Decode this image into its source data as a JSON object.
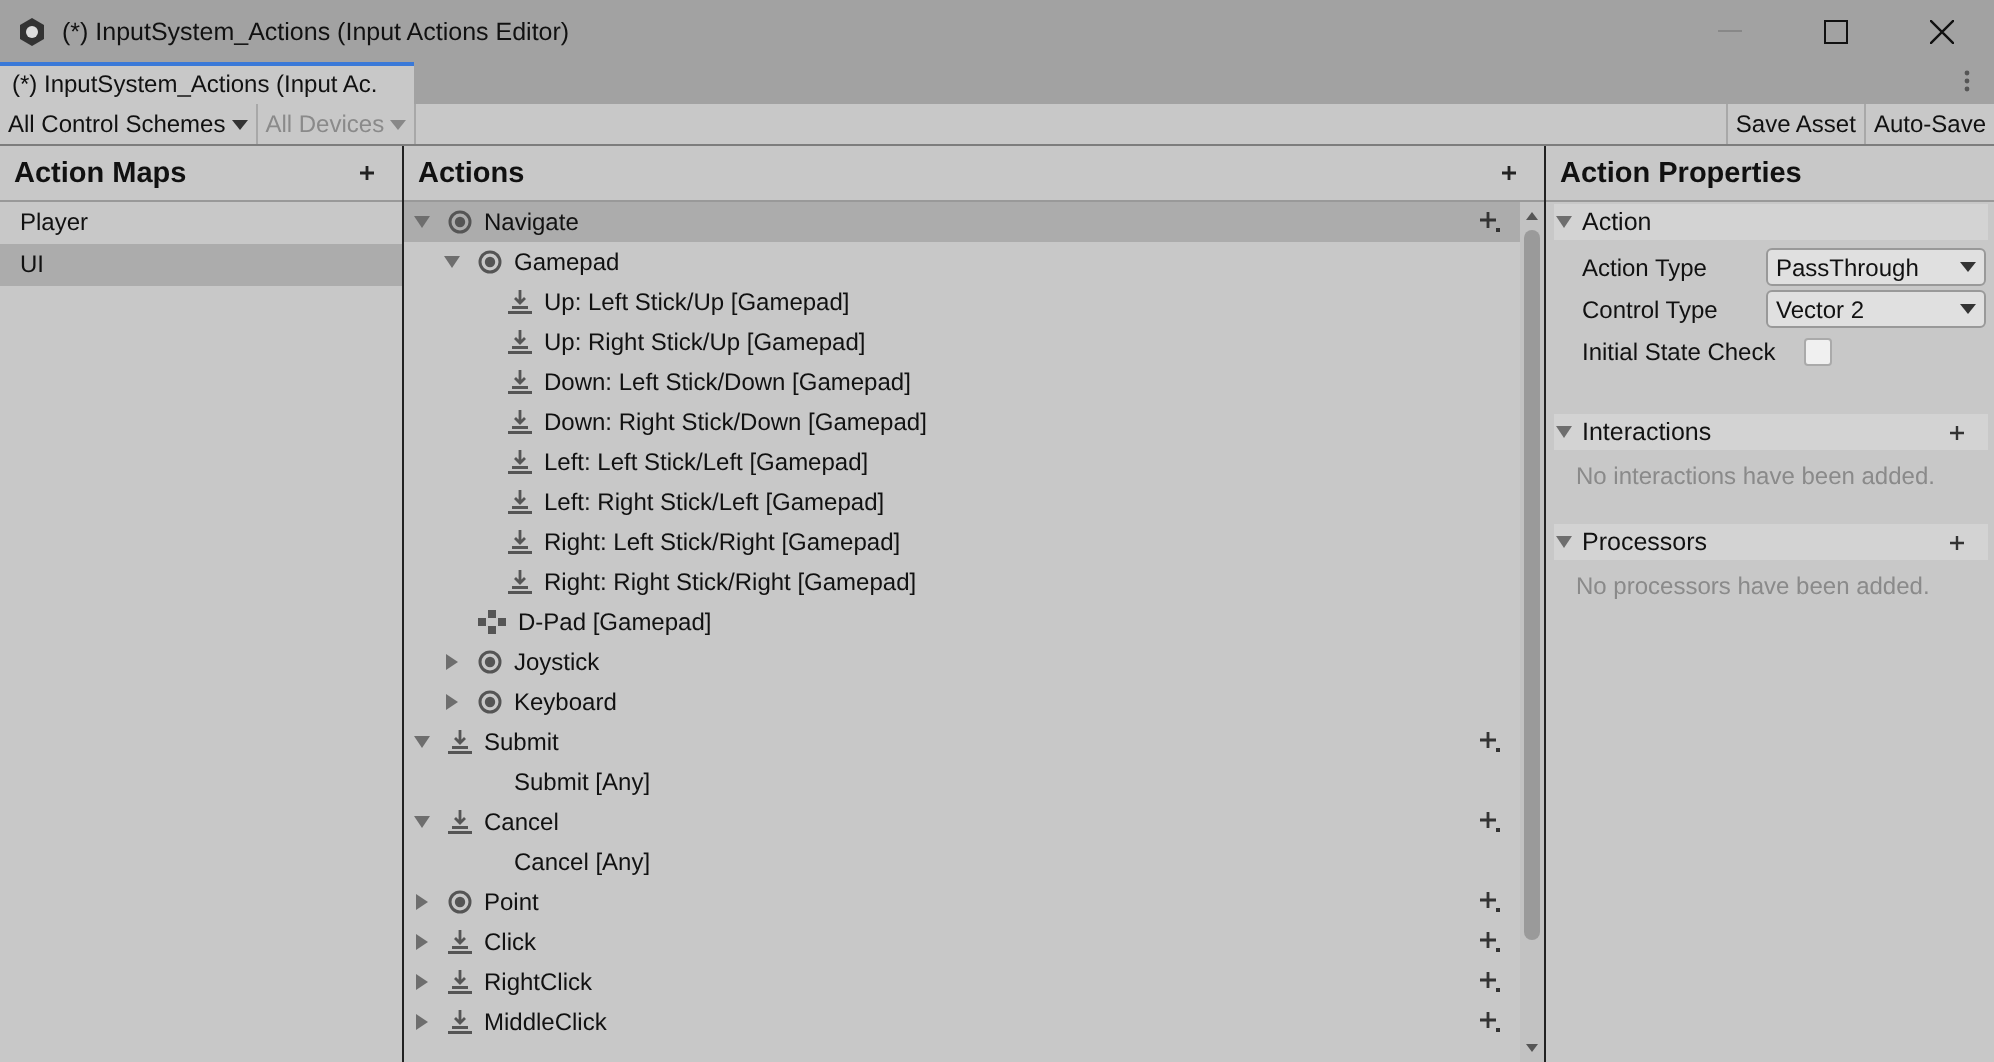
{
  "window": {
    "title": "(*) InputSystem_Actions (Input Actions Editor)"
  },
  "tab": {
    "label": "(*) InputSystem_Actions (Input Ac.",
    "selected": true
  },
  "toolbar": {
    "control_scheme": "All Control Schemes",
    "devices": {
      "label": "All Devices",
      "disabled": true
    },
    "save_asset": "Save Asset",
    "auto_save": "Auto-Save"
  },
  "action_maps": {
    "title": "Action Maps",
    "items": [
      {
        "label": "Player",
        "selected": false
      },
      {
        "label": "UI",
        "selected": true
      }
    ]
  },
  "actions": {
    "title": "Actions",
    "tree": [
      {
        "label": "Navigate",
        "kind": "value",
        "expanded": true,
        "selected": true,
        "children": [
          {
            "label": "Gamepad",
            "kind": "value",
            "expanded": true,
            "selected": false,
            "children": [
              {
                "label": "Up: Left Stick/Up [Gamepad]",
                "kind": "binding",
                "selected": false
              },
              {
                "label": "Up: Right Stick/Up [Gamepad]",
                "kind": "binding",
                "selected": false
              },
              {
                "label": "Down: Left Stick/Down [Gamepad]",
                "kind": "binding",
                "selected": false
              },
              {
                "label": "Down: Right Stick/Down [Gamepad]",
                "kind": "binding",
                "selected": false
              },
              {
                "label": "Left: Left Stick/Left [Gamepad]",
                "kind": "binding",
                "selected": false
              },
              {
                "label": "Left: Right Stick/Left [Gamepad]",
                "kind": "binding",
                "selected": false
              },
              {
                "label": "Right: Left Stick/Right [Gamepad]",
                "kind": "binding",
                "selected": false
              },
              {
                "label": "Right: Right Stick/Right [Gamepad]",
                "kind": "binding",
                "selected": false
              }
            ]
          },
          {
            "label": "D-Pad [Gamepad]",
            "kind": "dpad",
            "selected": false
          },
          {
            "label": "Joystick",
            "kind": "value",
            "expanded": false,
            "selected": false
          },
          {
            "label": "Keyboard",
            "kind": "value",
            "expanded": false,
            "selected": false
          }
        ]
      },
      {
        "label": "Submit",
        "kind": "button",
        "expanded": true,
        "selected": false,
        "children": [
          {
            "label": "Submit [Any]",
            "kind": "plain",
            "selected": false
          }
        ]
      },
      {
        "label": "Cancel",
        "kind": "button",
        "expanded": true,
        "selected": false,
        "children": [
          {
            "label": "Cancel [Any]",
            "kind": "plain",
            "selected": false
          }
        ]
      },
      {
        "label": "Point",
        "kind": "value",
        "expanded": false,
        "selected": false
      },
      {
        "label": "Click",
        "kind": "button",
        "expanded": false,
        "selected": false
      },
      {
        "label": "RightClick",
        "kind": "button",
        "expanded": false,
        "selected": false
      },
      {
        "label": "MiddleClick",
        "kind": "button",
        "expanded": false,
        "selected": false
      }
    ]
  },
  "properties": {
    "title": "Action Properties",
    "sections": [
      {
        "kind": "fields",
        "title": "Action",
        "expanded": true,
        "fields": [
          {
            "kind": "dropdown",
            "label": "Action Type",
            "value": "PassThrough"
          },
          {
            "kind": "dropdown",
            "label": "Control Type",
            "value": "Vector 2"
          },
          {
            "kind": "checkbox",
            "label": "Initial State Check",
            "checked": false
          }
        ]
      },
      {
        "kind": "list",
        "title": "Interactions",
        "expanded": true,
        "empty": "No interactions have been added."
      },
      {
        "kind": "list",
        "title": "Processors",
        "expanded": true,
        "empty": "No processors have been added."
      }
    ]
  }
}
